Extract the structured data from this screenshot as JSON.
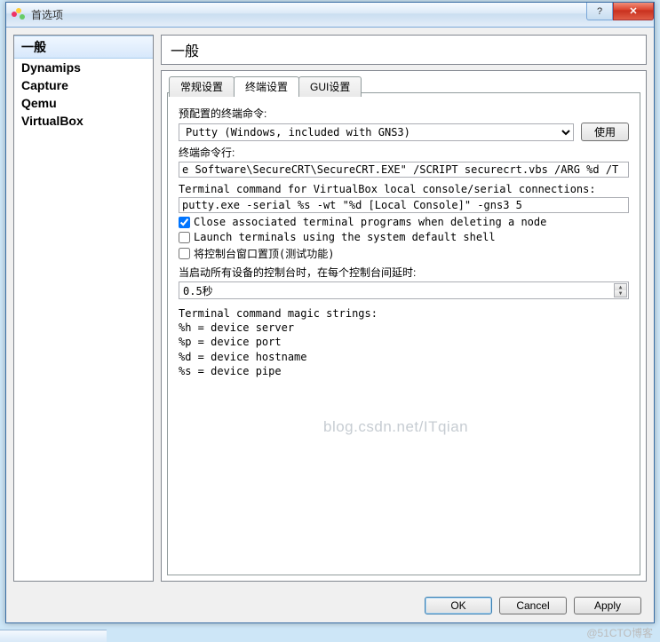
{
  "window": {
    "title": "首选项",
    "help_symbol": "?",
    "close_symbol": "✕"
  },
  "sidebar": {
    "items": [
      {
        "label": "一般",
        "selected": true
      },
      {
        "label": "Dynamips",
        "selected": false
      },
      {
        "label": "Capture",
        "selected": false
      },
      {
        "label": "Qemu",
        "selected": false
      },
      {
        "label": "VirtualBox",
        "selected": false
      }
    ]
  },
  "section_title": "一般",
  "tabs": [
    {
      "label": "常规设置",
      "active": false
    },
    {
      "label": "终端设置",
      "active": true
    },
    {
      "label": "GUI设置",
      "active": false
    }
  ],
  "panel": {
    "preconfigured_label": "预配置的终端命令:",
    "preconfigured_value": "Putty (Windows, included with GNS3)",
    "use_button": "使用",
    "terminal_cmd_label": "终端命令行:",
    "terminal_cmd_value": "e Software\\SecureCRT\\SecureCRT.EXE\" /SCRIPT securecrt.vbs /ARG %d /T /TELNET %h %p",
    "vbox_label": "Terminal command for VirtualBox local console/serial connections:",
    "vbox_value": "putty.exe -serial %s -wt \"%d [Local Console]\" -gns3 5",
    "chk_close_label": "Close associated terminal programs when deleting a node",
    "chk_close_checked": true,
    "chk_launch_label": "Launch terminals using the system default shell",
    "chk_launch_checked": false,
    "chk_console_label": "将控制台窗口置顶(测试功能)",
    "chk_console_checked": false,
    "delay_label": "当启动所有设备的控制台时，在每个控制台间延时:",
    "delay_value": "0.5秒",
    "help_heading": "Terminal command magic strings:",
    "help_lines": [
      "%h = device server",
      "%p = device port",
      "%d = device hostname",
      "%s = device pipe"
    ]
  },
  "footer": {
    "ok": "OK",
    "cancel": "Cancel",
    "apply": "Apply"
  },
  "watermark": "blog.csdn.net/ITqian",
  "attribution": "@51CTO博客"
}
